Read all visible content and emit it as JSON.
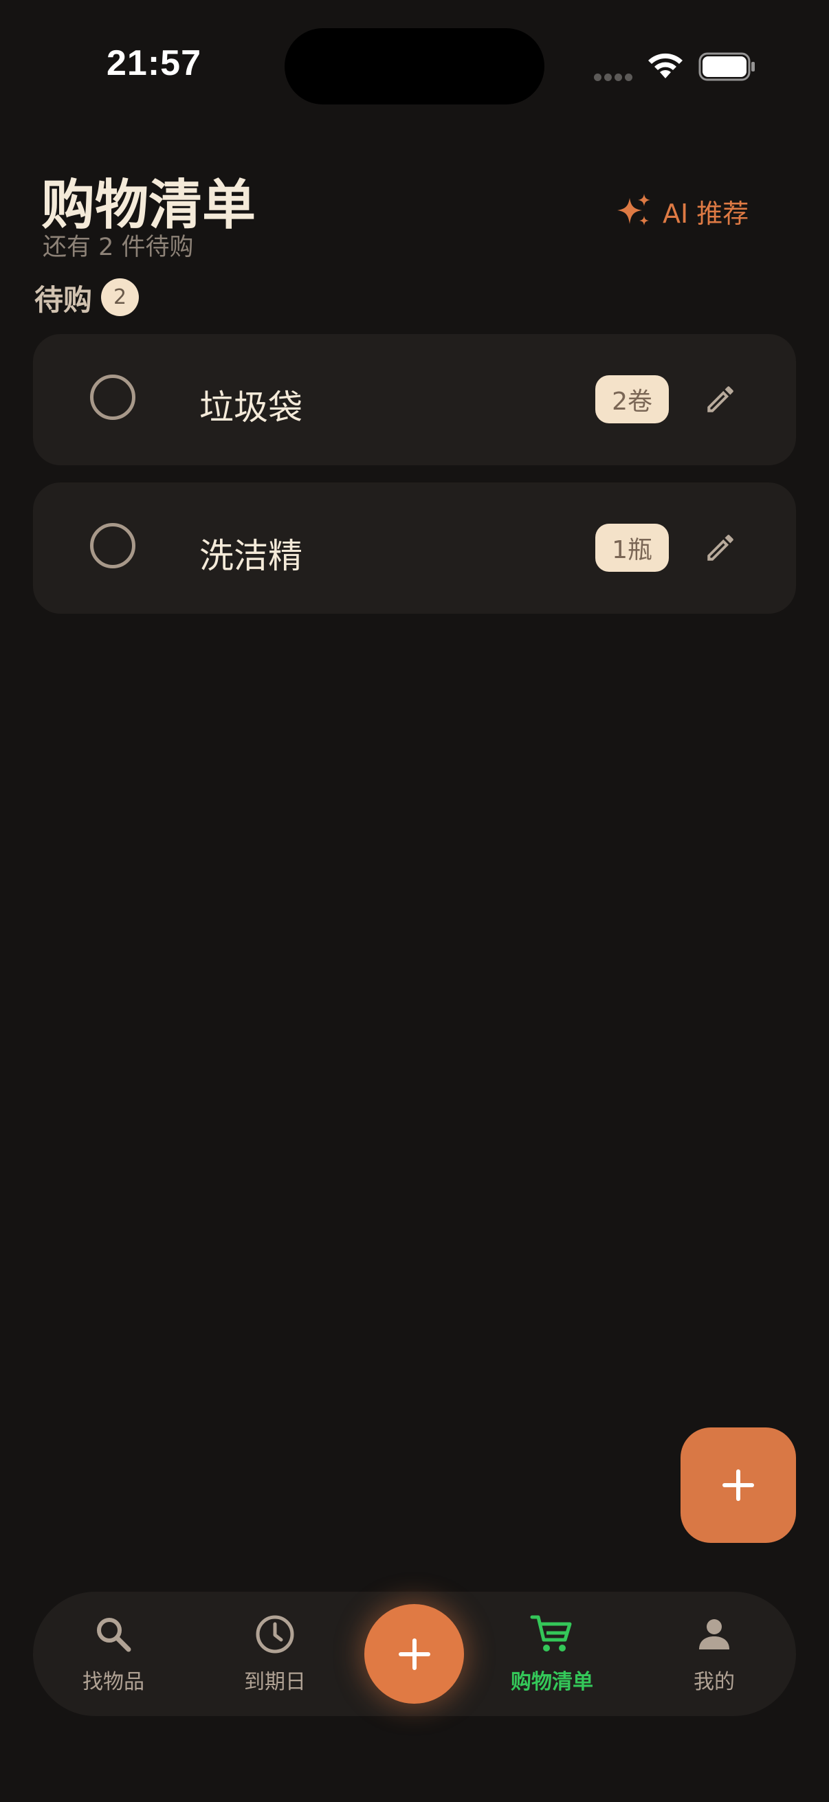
{
  "status_bar": {
    "time": "21:57"
  },
  "header": {
    "title": "购物清单",
    "subtitle": "还有 2 件待购",
    "ai_button_label": "AI 推荐",
    "ai_button_icon": "sparkles-icon"
  },
  "section": {
    "label": "待购",
    "count": "2"
  },
  "items": [
    {
      "name": "垃圾袋",
      "quantity": "2卷",
      "checked": false
    },
    {
      "name": "洗洁精",
      "quantity": "1瓶",
      "checked": false
    }
  ],
  "fab": {
    "icon": "plus-icon"
  },
  "bottom_nav": {
    "items": [
      {
        "label": "找物品",
        "icon": "search-icon",
        "active": false
      },
      {
        "label": "到期日",
        "icon": "clock-icon",
        "active": false
      },
      {
        "label": "购物清单",
        "icon": "cart-icon",
        "active": true
      },
      {
        "label": "我的",
        "icon": "person-icon",
        "active": false
      }
    ],
    "center_button_icon": "plus-icon"
  },
  "colors": {
    "background": "#151312",
    "card": "#211e1c",
    "accent": "#de7a44",
    "active_tab": "#34c759",
    "badge": "#f4e2c9",
    "title": "#f4ead9"
  }
}
